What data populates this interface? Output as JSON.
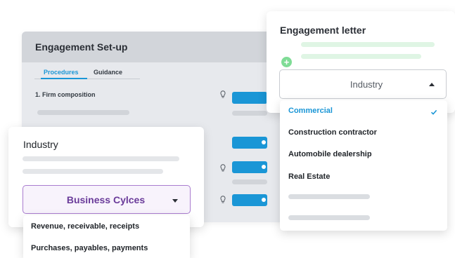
{
  "setup": {
    "title": "Engagement Set-up",
    "tabs": [
      {
        "label": "Procedures",
        "active": true
      },
      {
        "label": "Guidance",
        "active": false
      }
    ],
    "procedures": [
      {
        "label": "1. Firm composition"
      }
    ]
  },
  "letter": {
    "title": "Engagement letter",
    "add_icon": "plus-circle-icon",
    "select": {
      "value": "Industry",
      "caret": "chevron-up-icon"
    }
  },
  "industry_options": [
    {
      "label": "Commercial",
      "selected": true
    },
    {
      "label": "Construction contractor",
      "selected": false
    },
    {
      "label": "Automobile dealership",
      "selected": false
    },
    {
      "label": "Real Estate",
      "selected": false
    }
  ],
  "industry_card": {
    "title": "Industry",
    "select": {
      "value": "Business Cylces",
      "caret": "chevron-down-icon"
    },
    "options": [
      {
        "label": "Revenue, receivable, receipts"
      },
      {
        "label": "Purchases, payables, payments"
      }
    ]
  },
  "colors": {
    "accent": "#1a96d6",
    "purple": "#6a3b9a",
    "green": "#7fdc96"
  }
}
